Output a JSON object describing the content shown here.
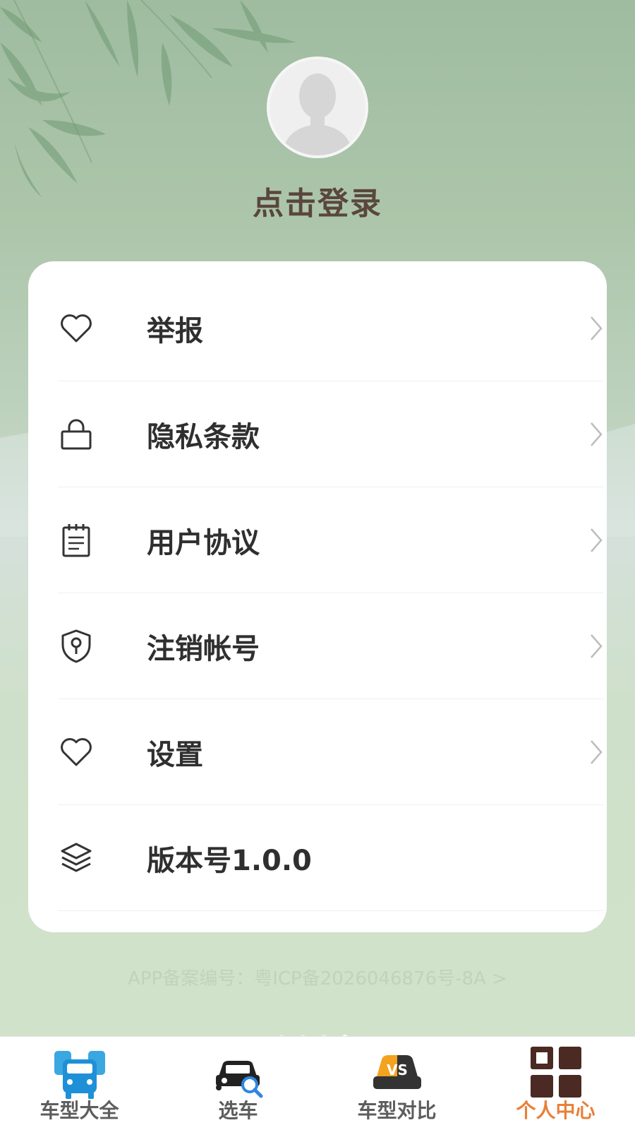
{
  "profile": {
    "login_text": "点击登录"
  },
  "menu": [
    {
      "label": "举报",
      "icon": "heart-icon"
    },
    {
      "label": "隐私条款",
      "icon": "lock-icon"
    },
    {
      "label": "用户协议",
      "icon": "notepad-icon"
    },
    {
      "label": "注销帐号",
      "icon": "shield-key-icon"
    },
    {
      "label": "设置",
      "icon": "heart-icon"
    },
    {
      "label": "版本号1.0.0",
      "icon": "layers-icon"
    }
  ],
  "footer": {
    "icp_text": "APP备案编号：粤ICP备2026046876号-8A >"
  },
  "tabbar": {
    "tabs": [
      {
        "label": "车型大全",
        "icon": "car-lineup-icon",
        "active": false
      },
      {
        "label": "选车",
        "icon": "car-search-icon",
        "active": false
      },
      {
        "label": "车型对比",
        "icon": "car-vs-icon",
        "active": false
      },
      {
        "label": "个人中心",
        "icon": "grid-icon",
        "active": true
      }
    ]
  },
  "colors": {
    "accent": "#e9803a",
    "title": "#5a463d",
    "card": "#ffffff"
  }
}
